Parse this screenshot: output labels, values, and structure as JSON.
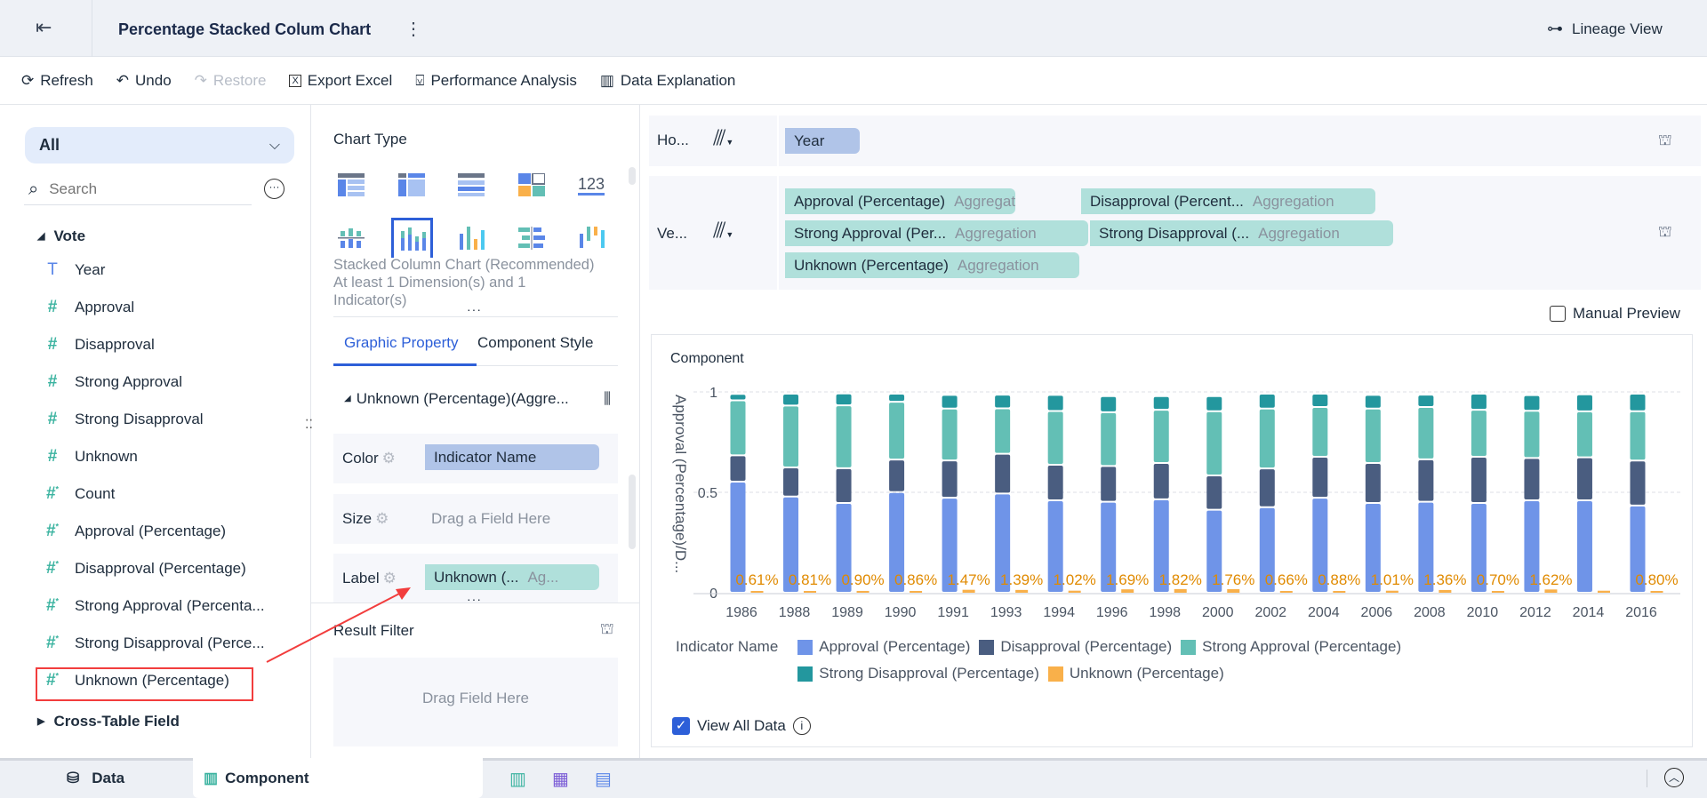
{
  "header": {
    "title": "Percentage Stacked Colum Chart",
    "lineage": "Lineage View"
  },
  "toolbar": {
    "refresh": "Refresh",
    "undo": "Undo",
    "restore": "Restore",
    "export": "Export Excel",
    "performance": "Performance Analysis",
    "explanation": "Data Explanation"
  },
  "left": {
    "dropdown": "All",
    "search_placeholder": "Search",
    "group": "Vote",
    "fields": [
      {
        "label": "Year",
        "type": "text"
      },
      {
        "label": "Approval",
        "type": "num"
      },
      {
        "label": "Disapproval",
        "type": "num"
      },
      {
        "label": "Strong Approval",
        "type": "num"
      },
      {
        "label": "Strong Disapproval",
        "type": "num"
      },
      {
        "label": "Unknown",
        "type": "num"
      },
      {
        "label": "Count",
        "type": "calc"
      },
      {
        "label": "Approval (Percentage)",
        "type": "calc"
      },
      {
        "label": "Disapproval (Percentage)",
        "type": "calc"
      },
      {
        "label": "Strong Approval (Percenta...",
        "type": "calc"
      },
      {
        "label": "Strong Disapproval (Perce...",
        "type": "calc"
      },
      {
        "label": "Unknown (Percentage)",
        "type": "calc"
      }
    ],
    "cross_table": "Cross-Table Field"
  },
  "mid": {
    "chart_type_title": "Chart Type",
    "chart_desc": "Stacked Column Chart (Recommended) At least 1 Dimension(s) and 1 Indicator(s)",
    "tabs": [
      "Graphic Property",
      "Component Style"
    ],
    "series_header": "Unknown (Percentage)(Aggre...",
    "color_label": "Color",
    "color_value": "Indicator Name",
    "size_label": "Size",
    "size_placeholder": "Drag a Field Here",
    "label_label": "Label",
    "label_value": "Unknown (...",
    "label_agg": "Ag...",
    "result_filter": "Result Filter",
    "filter_placeholder": "Drag Field Here"
  },
  "axes": {
    "horizontal_label": "Ho...",
    "vertical_label": "Ve...",
    "horizontal_fields": [
      "Year"
    ],
    "vertical_fields": [
      {
        "name": "Approval (Percentage)",
        "agg": "Aggregation"
      },
      {
        "name": "Disapproval (Percent...",
        "agg": "Aggregation"
      },
      {
        "name": "Strong Approval (Per...",
        "agg": "Aggregation"
      },
      {
        "name": "Strong Disapproval (...",
        "agg": "Aggregation"
      },
      {
        "name": "Unknown (Percentage)",
        "agg": "Aggregation"
      }
    ]
  },
  "manual_preview": "Manual Preview",
  "component_title": "Component",
  "view_all_data": "View All Data",
  "bottom": {
    "data_tab": "Data",
    "component_tab": "Component"
  },
  "chart_data": {
    "type": "bar",
    "stacked": "percent",
    "categories": [
      "1986",
      "1988",
      "1989",
      "1990",
      "1991",
      "1993",
      "1994",
      "1996",
      "1998",
      "2000",
      "2002",
      "2004",
      "2006",
      "2008",
      "2010",
      "2012",
      "2014",
      "2016"
    ],
    "ylabel": "Approval (Percentage)/D...",
    "yticks": [
      "0",
      "0.5",
      "1"
    ],
    "ylim": [
      0,
      1
    ],
    "legend_title": "Indicator Name",
    "series": [
      {
        "name": "Approval (Percentage)",
        "color": "#6f94e8",
        "values": [
          0.553,
          0.479,
          0.447,
          0.501,
          0.473,
          0.494,
          0.46,
          0.453,
          0.465,
          0.413,
          0.426,
          0.473,
          0.447,
          0.453,
          0.447,
          0.46,
          0.46,
          0.434
        ]
      },
      {
        "name": "Disapproval (Percentage)",
        "color": "#4a5d80",
        "values": [
          0.131,
          0.145,
          0.173,
          0.162,
          0.186,
          0.198,
          0.177,
          0.178,
          0.181,
          0.171,
          0.193,
          0.204,
          0.199,
          0.211,
          0.23,
          0.211,
          0.214,
          0.224
        ]
      },
      {
        "name": "Strong Approval (Percentage)",
        "color": "#63bfb5",
        "values": [
          0.274,
          0.308,
          0.313,
          0.288,
          0.258,
          0.226,
          0.268,
          0.268,
          0.265,
          0.32,
          0.298,
          0.248,
          0.271,
          0.261,
          0.234,
          0.235,
          0.229,
          0.246
        ]
      },
      {
        "name": "Strong Disapproval (Percentage)",
        "color": "#23979e",
        "values": [
          0.032,
          0.059,
          0.059,
          0.04,
          0.068,
          0.068,
          0.08,
          0.08,
          0.068,
          0.075,
          0.074,
          0.066,
          0.068,
          0.061,
          0.08,
          0.078,
          0.085,
          0.087
        ]
      },
      {
        "name": "Unknown (Percentage)",
        "color": "#f9b04a",
        "values": [
          0.0061,
          0.0081,
          0.009,
          0.0086,
          0.0147,
          0.0139,
          0.0102,
          0.0169,
          0.0182,
          0.0176,
          0.0066,
          0.0088,
          0.0101,
          0.0136,
          0.007,
          0.0162,
          0.01,
          0.008
        ]
      }
    ],
    "unknown_labels": [
      "0.61%",
      "0.81%",
      "0.90%",
      "0.86%",
      "1.47%",
      "1.39%",
      "1.02%",
      "1.69%",
      "1.82%",
      "1.76%",
      "0.66%",
      "0.88%",
      "1.01%",
      "1.36%",
      "0.70%",
      "1.62%",
      "",
      "0.80%"
    ]
  }
}
